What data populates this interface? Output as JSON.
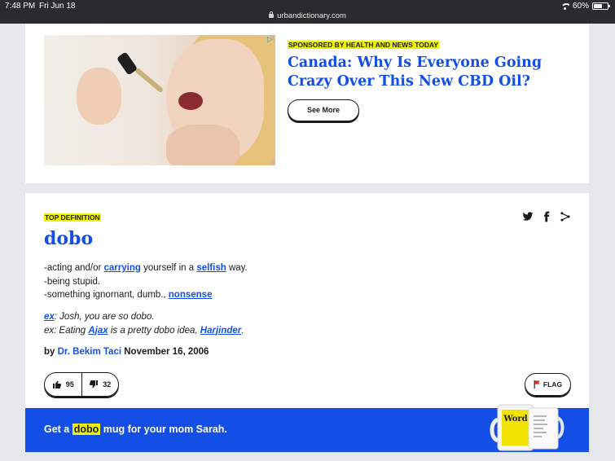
{
  "status_bar": {
    "time": "7:48 PM",
    "date": "Fri Jun 18",
    "url": "urbandictionary.com",
    "battery": "60%",
    "battery_level": 0.6
  },
  "ad": {
    "sponsored_label": "SPONSORED BY HEALTH AND NEWS TODAY",
    "title": "Canada: Why Is Everyone Going Crazy Over This New CBD Oil?",
    "see_more": "See More",
    "ad_choice_icon": "adchoices-icon"
  },
  "definition": {
    "badge": "TOP DEFINITION",
    "word": "dobo",
    "meaning": {
      "line1_prefix": "-acting and/or ",
      "line1_link1": "carrying",
      "line1_mid": " yourself in a ",
      "line1_link2": "selfish",
      "line1_suffix": " way.",
      "line2": "-being stupid.",
      "line3_prefix": "-something ignornant, dumb., ",
      "line3_link": "nonsense"
    },
    "example": {
      "line1_link": "ex",
      "line1_text": ": Josh, you are so dobo.",
      "line2_prefix": "ex: Eating ",
      "line2_link1": "Ajax",
      "line2_mid": " is a pretty dobo idea, ",
      "line2_link2": "Harjinder",
      "line2_suffix": "."
    },
    "byline": {
      "by": "by",
      "author": "Dr. Bekim Taci",
      "date": "November 16, 2006"
    },
    "votes": {
      "up": "95",
      "down": "32"
    },
    "flag_label": "FLAG",
    "mug": {
      "prefix": "Get a ",
      "word": "dobo",
      "suffix": " mug for your mom Sarah.",
      "mug_word": "Word"
    },
    "colors": {
      "link": "#134fe6",
      "highlight": "#eef400",
      "bar": "#134fe6"
    }
  }
}
